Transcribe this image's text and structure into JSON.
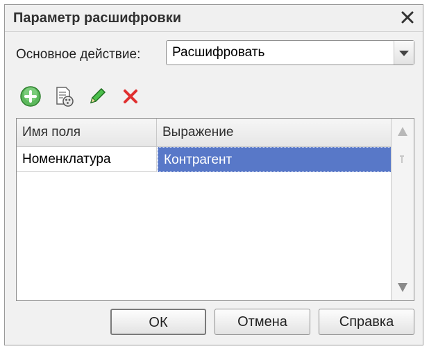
{
  "window": {
    "title": "Параметр расшифровки"
  },
  "main_action": {
    "label": "Основное действие:",
    "value": "Расшифровать"
  },
  "toolbar": {
    "icons": [
      "add-icon",
      "copy-icon",
      "edit-icon",
      "delete-icon"
    ],
    "colors": {
      "add": "#3a9a3a",
      "edit": "#2e9a2e",
      "delete": "#e03030"
    }
  },
  "table": {
    "columns": [
      "Имя поля",
      "Выражение"
    ],
    "rows": [
      [
        "Номенклатура",
        "Контрагент"
      ]
    ]
  },
  "buttons": {
    "ok": "ОК",
    "cancel": "Отмена",
    "help": "Справка"
  },
  "colors": {
    "selection": "#5878c8"
  }
}
